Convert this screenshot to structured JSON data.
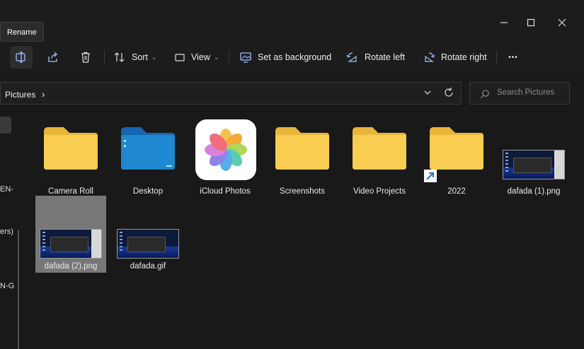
{
  "tooltip": "Rename",
  "toolbar": {
    "sort_label": "Sort",
    "view_label": "View",
    "set_background_label": "Set as background",
    "rotate_left_label": "Rotate left",
    "rotate_right_label": "Rotate right",
    "more_label": "•••"
  },
  "address": {
    "crumb": "Pictures",
    "separator": "›"
  },
  "search": {
    "placeholder": "Search Pictures"
  },
  "nav": {
    "fragments": [
      "EN-",
      "ers)",
      "N-G"
    ]
  },
  "items": [
    {
      "name": "Camera Roll",
      "type": "folder"
    },
    {
      "name": "Desktop",
      "type": "folder-blue"
    },
    {
      "name": "iCloud Photos",
      "type": "app"
    },
    {
      "name": "Screenshots",
      "type": "folder"
    },
    {
      "name": "Video Projects",
      "type": "folder"
    },
    {
      "name": "2022",
      "type": "folder-shortcut"
    },
    {
      "name": "dafada  (1).png",
      "type": "image"
    },
    {
      "name": "dafada  (2).png",
      "type": "image",
      "selected": true
    },
    {
      "name": "dafada.gif",
      "type": "image"
    }
  ],
  "colors": {
    "folder": "#f9cd52",
    "folder_blue": "#1e88d0",
    "selection": "#777777",
    "background": "#191919"
  }
}
